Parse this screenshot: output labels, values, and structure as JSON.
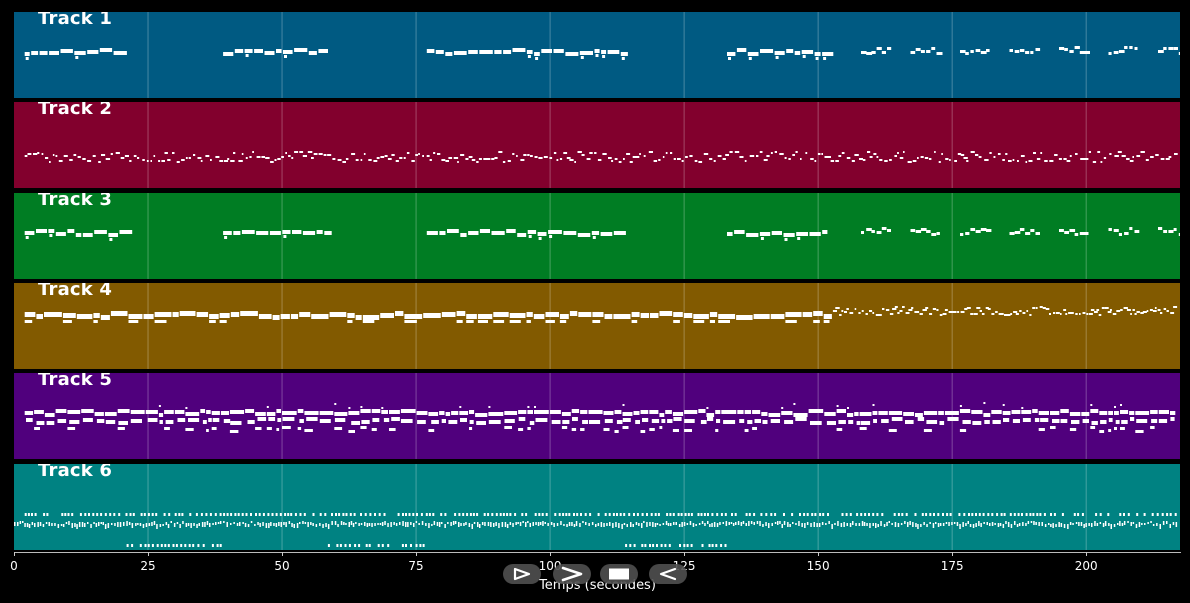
{
  "tracks": [
    {
      "name": "Track 1",
      "color": "#005a82",
      "pattern": "blocks_phrases"
    },
    {
      "name": "Track 2",
      "color": "#82002d",
      "pattern": "sparse_dots"
    },
    {
      "name": "Track 3",
      "color": "#007d23",
      "pattern": "blocks_phrases"
    },
    {
      "name": "Track 4",
      "color": "#825a00",
      "pattern": "dense_line"
    },
    {
      "name": "Track 5",
      "color": "#50007d",
      "pattern": "dense_multi"
    },
    {
      "name": "Track 6",
      "color": "#008282",
      "pattern": "small_multi"
    }
  ],
  "axis": {
    "xlabel": "Temps (secondes)",
    "ticks": [
      "0",
      "25",
      "50",
      "75",
      "100",
      "125",
      "150",
      "175",
      "200"
    ],
    "tick_values": [
      0,
      25,
      50,
      75,
      100,
      125,
      150,
      175,
      200
    ],
    "xlim": [
      0,
      217.5
    ]
  },
  "controls": [
    {
      "name": "play-from-start-button",
      "icon": "play-outline-icon"
    },
    {
      "name": "forward-button",
      "icon": "chevron-right-icon"
    },
    {
      "name": "stop-button",
      "icon": "stop-icon"
    },
    {
      "name": "rewind-button",
      "icon": "play-reverse-icon"
    }
  ]
}
